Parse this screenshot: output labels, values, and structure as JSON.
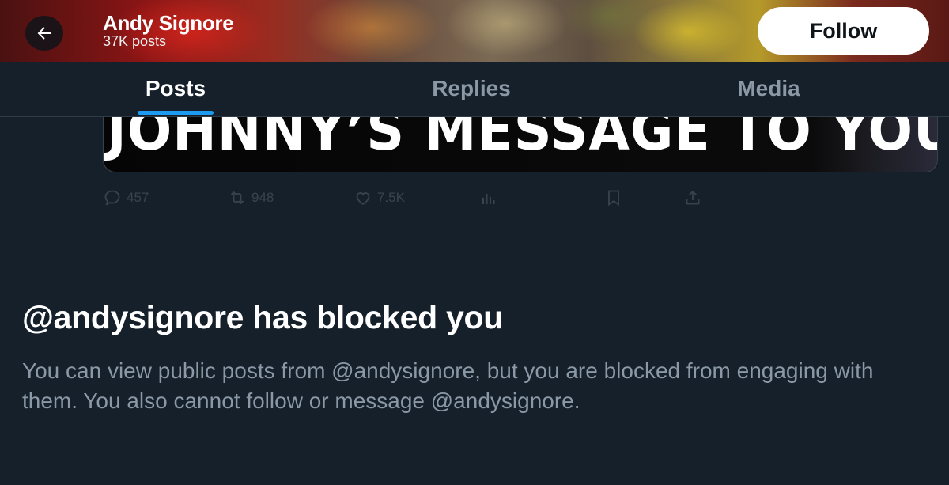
{
  "header": {
    "name": "Andy Signore",
    "post_count": "37K posts",
    "back_icon": "arrow-left-icon",
    "follow_label": "Follow"
  },
  "tabs": [
    {
      "label": "Posts",
      "active": true
    },
    {
      "label": "Replies",
      "active": false
    },
    {
      "label": "Media",
      "active": false
    }
  ],
  "post": {
    "image_text": "JOHNNY’S MESSAGE TO YOU!",
    "actions": [
      {
        "icon": "reply-icon",
        "count": "457"
      },
      {
        "icon": "repost-icon",
        "count": "948"
      },
      {
        "icon": "like-icon",
        "count": "7.5K"
      },
      {
        "icon": "views-icon",
        "count": ""
      },
      {
        "icon": "bookmark-icon",
        "count": ""
      },
      {
        "icon": "share-icon",
        "count": ""
      }
    ]
  },
  "blocked": {
    "title": "@andysignore has blocked you",
    "description": "You can view public posts from @andysignore, but you are blocked from engaging with them. You also cannot follow or message @andysignore."
  },
  "colors": {
    "background": "#15202b",
    "accent": "#1d9bf0",
    "muted_text": "#8b98a5",
    "divider": "#2f3b47"
  }
}
